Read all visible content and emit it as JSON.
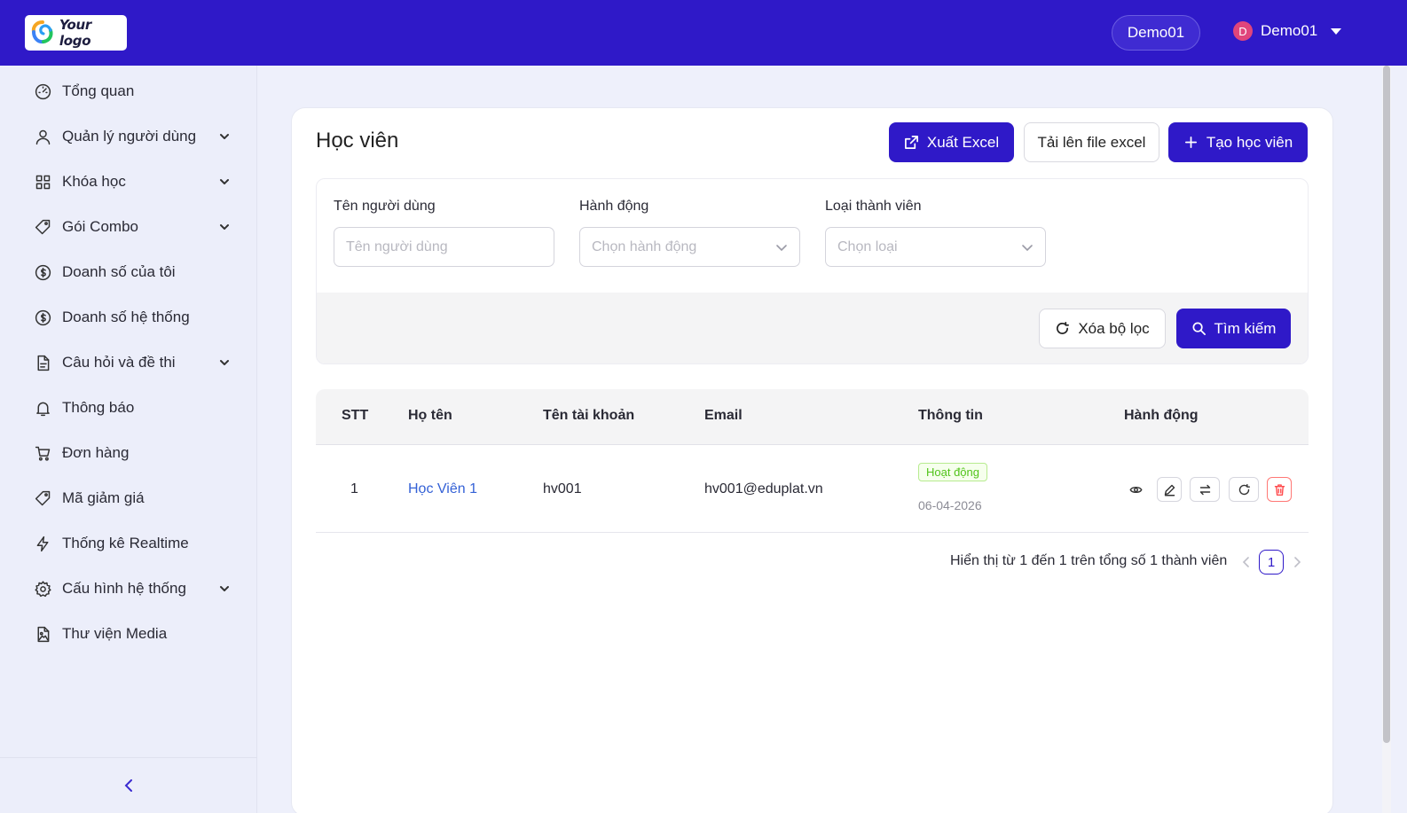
{
  "header": {
    "logo_text": "Your logo",
    "tenant": "Demo01",
    "user": {
      "initial": "D",
      "name": "Demo01"
    }
  },
  "sidebar": {
    "items": [
      {
        "label": "Tổng quan",
        "icon": "dashboard-icon",
        "expandable": false
      },
      {
        "label": "Quản lý người dùng",
        "icon": "user-icon",
        "expandable": true
      },
      {
        "label": "Khóa học",
        "icon": "grid-icon",
        "expandable": true
      },
      {
        "label": "Gói Combo",
        "icon": "tag-icon",
        "expandable": true
      },
      {
        "label": "Doanh số của tôi",
        "icon": "dollar-icon",
        "expandable": false
      },
      {
        "label": "Doanh số hệ thống",
        "icon": "dollar-icon",
        "expandable": false
      },
      {
        "label": "Câu hỏi và đề thi",
        "icon": "document-icon",
        "expandable": true
      },
      {
        "label": "Thông báo",
        "icon": "bell-icon",
        "expandable": false
      },
      {
        "label": "Đơn hàng",
        "icon": "cart-icon",
        "expandable": false
      },
      {
        "label": "Mã giảm giá",
        "icon": "tag-icon",
        "expandable": false
      },
      {
        "label": "Thống kê Realtime",
        "icon": "lightning-icon",
        "expandable": false
      },
      {
        "label": "Cấu hình hệ thống",
        "icon": "gear-icon",
        "expandable": true
      },
      {
        "label": "Thư viện Media",
        "icon": "media-file-icon",
        "expandable": false
      }
    ]
  },
  "page": {
    "title": "Học viên",
    "buttons": {
      "export": "Xuất Excel",
      "upload": "Tải lên file excel",
      "create": "Tạo học viên"
    }
  },
  "filters": {
    "username": {
      "label": "Tên người dùng",
      "placeholder": "Tên người dùng",
      "value": ""
    },
    "action": {
      "label": "Hành động",
      "placeholder": "Chọn hành động"
    },
    "member_type": {
      "label": "Loại thành viên",
      "placeholder": "Chọn loại"
    },
    "clear_label": "Xóa bộ lọc",
    "search_label": "Tìm kiếm"
  },
  "table": {
    "columns": [
      "STT",
      "Họ tên",
      "Tên tài khoản",
      "Email",
      "Thông tin",
      "Hành động"
    ],
    "rows": [
      {
        "stt": "1",
        "name": "Học Viên 1",
        "username": "hv001",
        "email": "hv001@eduplat.vn",
        "status": "Hoạt động",
        "date": "06-04-2026"
      }
    ]
  },
  "pagination": {
    "summary": "Hiển thị từ 1 đến 1 trên tổng số 1 thành viên",
    "current_page": "1"
  },
  "colors": {
    "primary": "#2f19c8",
    "status_active": "#52c41a",
    "danger": "#ff4d4f",
    "link": "#3461d6"
  }
}
